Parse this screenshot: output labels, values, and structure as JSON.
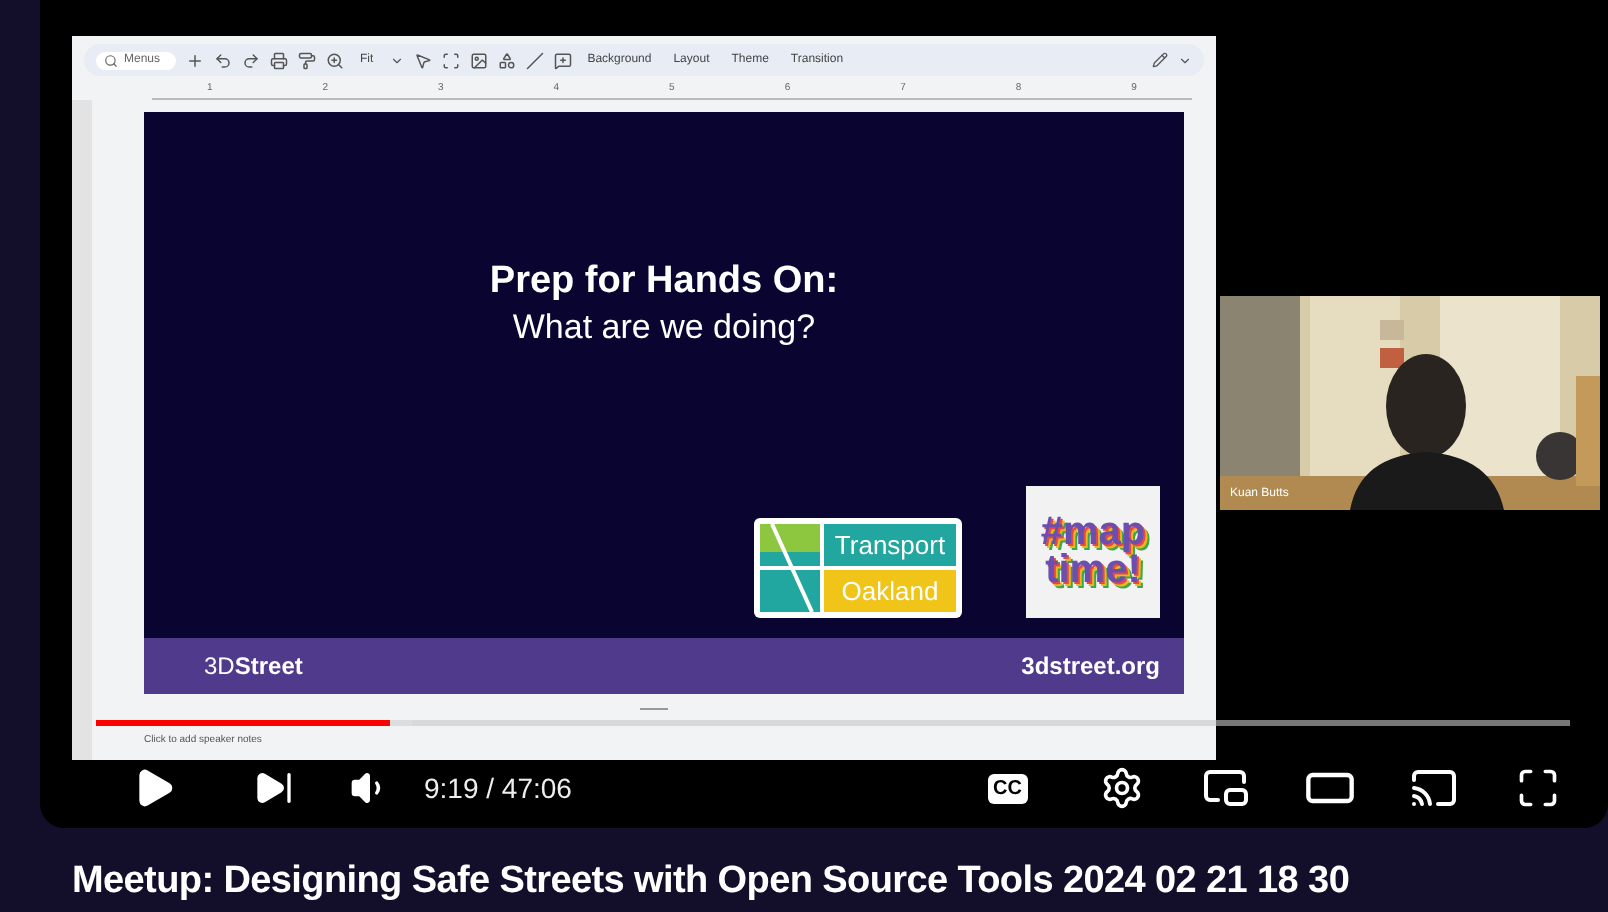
{
  "slides_app": {
    "toolbar": {
      "search_placeholder": "Menus",
      "zoom": "Fit",
      "buttons": [
        "Background",
        "Layout",
        "Theme",
        "Transition"
      ]
    },
    "ruler": [
      "1",
      "2",
      "3",
      "4",
      "5",
      "6",
      "7",
      "8",
      "9"
    ],
    "slide": {
      "title": "Prep for Hands On:",
      "subtitle": "What are we doing?",
      "logos": [
        {
          "kind": "transport",
          "lines": [
            "Transport",
            "Oakland"
          ]
        },
        {
          "kind": "maptime",
          "lines": [
            "#map",
            "time!"
          ]
        }
      ],
      "footer_left": "3D**Street**",
      "footer_right": "3dstreet.org"
    },
    "speaker_notes": {
      "placeholder": "Click to add speaker notes"
    }
  },
  "webcam": {
    "kind": "picture",
    "name": "Kuan Butts"
  },
  "player": {
    "progress": {
      "level": 0.2
    },
    "time": "9:19 / 47:06",
    "captions": "CC"
  },
  "video_title": "Meetup: Designing Safe Streets with Open Source Tools 2024 02 21 18 30"
}
